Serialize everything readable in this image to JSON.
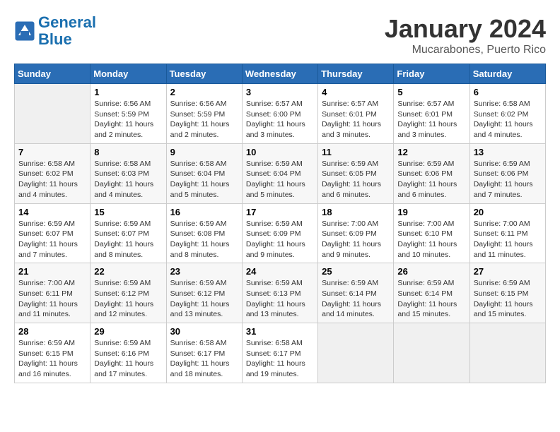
{
  "header": {
    "logo_line1": "General",
    "logo_line2": "Blue",
    "month": "January 2024",
    "location": "Mucarabones, Puerto Rico"
  },
  "days_of_week": [
    "Sunday",
    "Monday",
    "Tuesday",
    "Wednesday",
    "Thursday",
    "Friday",
    "Saturday"
  ],
  "weeks": [
    [
      {
        "day": "",
        "info": ""
      },
      {
        "day": "1",
        "info": "Sunrise: 6:56 AM\nSunset: 5:59 PM\nDaylight: 11 hours\nand 2 minutes."
      },
      {
        "day": "2",
        "info": "Sunrise: 6:56 AM\nSunset: 5:59 PM\nDaylight: 11 hours\nand 2 minutes."
      },
      {
        "day": "3",
        "info": "Sunrise: 6:57 AM\nSunset: 6:00 PM\nDaylight: 11 hours\nand 3 minutes."
      },
      {
        "day": "4",
        "info": "Sunrise: 6:57 AM\nSunset: 6:01 PM\nDaylight: 11 hours\nand 3 minutes."
      },
      {
        "day": "5",
        "info": "Sunrise: 6:57 AM\nSunset: 6:01 PM\nDaylight: 11 hours\nand 3 minutes."
      },
      {
        "day": "6",
        "info": "Sunrise: 6:58 AM\nSunset: 6:02 PM\nDaylight: 11 hours\nand 4 minutes."
      }
    ],
    [
      {
        "day": "7",
        "info": "Sunrise: 6:58 AM\nSunset: 6:02 PM\nDaylight: 11 hours\nand 4 minutes."
      },
      {
        "day": "8",
        "info": "Sunrise: 6:58 AM\nSunset: 6:03 PM\nDaylight: 11 hours\nand 4 minutes."
      },
      {
        "day": "9",
        "info": "Sunrise: 6:58 AM\nSunset: 6:04 PM\nDaylight: 11 hours\nand 5 minutes."
      },
      {
        "day": "10",
        "info": "Sunrise: 6:59 AM\nSunset: 6:04 PM\nDaylight: 11 hours\nand 5 minutes."
      },
      {
        "day": "11",
        "info": "Sunrise: 6:59 AM\nSunset: 6:05 PM\nDaylight: 11 hours\nand 6 minutes."
      },
      {
        "day": "12",
        "info": "Sunrise: 6:59 AM\nSunset: 6:06 PM\nDaylight: 11 hours\nand 6 minutes."
      },
      {
        "day": "13",
        "info": "Sunrise: 6:59 AM\nSunset: 6:06 PM\nDaylight: 11 hours\nand 7 minutes."
      }
    ],
    [
      {
        "day": "14",
        "info": "Sunrise: 6:59 AM\nSunset: 6:07 PM\nDaylight: 11 hours\nand 7 minutes."
      },
      {
        "day": "15",
        "info": "Sunrise: 6:59 AM\nSunset: 6:07 PM\nDaylight: 11 hours\nand 8 minutes."
      },
      {
        "day": "16",
        "info": "Sunrise: 6:59 AM\nSunset: 6:08 PM\nDaylight: 11 hours\nand 8 minutes."
      },
      {
        "day": "17",
        "info": "Sunrise: 6:59 AM\nSunset: 6:09 PM\nDaylight: 11 hours\nand 9 minutes."
      },
      {
        "day": "18",
        "info": "Sunrise: 7:00 AM\nSunset: 6:09 PM\nDaylight: 11 hours\nand 9 minutes."
      },
      {
        "day": "19",
        "info": "Sunrise: 7:00 AM\nSunset: 6:10 PM\nDaylight: 11 hours\nand 10 minutes."
      },
      {
        "day": "20",
        "info": "Sunrise: 7:00 AM\nSunset: 6:11 PM\nDaylight: 11 hours\nand 11 minutes."
      }
    ],
    [
      {
        "day": "21",
        "info": "Sunrise: 7:00 AM\nSunset: 6:11 PM\nDaylight: 11 hours\nand 11 minutes."
      },
      {
        "day": "22",
        "info": "Sunrise: 6:59 AM\nSunset: 6:12 PM\nDaylight: 11 hours\nand 12 minutes."
      },
      {
        "day": "23",
        "info": "Sunrise: 6:59 AM\nSunset: 6:12 PM\nDaylight: 11 hours\nand 13 minutes."
      },
      {
        "day": "24",
        "info": "Sunrise: 6:59 AM\nSunset: 6:13 PM\nDaylight: 11 hours\nand 13 minutes."
      },
      {
        "day": "25",
        "info": "Sunrise: 6:59 AM\nSunset: 6:14 PM\nDaylight: 11 hours\nand 14 minutes."
      },
      {
        "day": "26",
        "info": "Sunrise: 6:59 AM\nSunset: 6:14 PM\nDaylight: 11 hours\nand 15 minutes."
      },
      {
        "day": "27",
        "info": "Sunrise: 6:59 AM\nSunset: 6:15 PM\nDaylight: 11 hours\nand 15 minutes."
      }
    ],
    [
      {
        "day": "28",
        "info": "Sunrise: 6:59 AM\nSunset: 6:15 PM\nDaylight: 11 hours\nand 16 minutes."
      },
      {
        "day": "29",
        "info": "Sunrise: 6:59 AM\nSunset: 6:16 PM\nDaylight: 11 hours\nand 17 minutes."
      },
      {
        "day": "30",
        "info": "Sunrise: 6:58 AM\nSunset: 6:17 PM\nDaylight: 11 hours\nand 18 minutes."
      },
      {
        "day": "31",
        "info": "Sunrise: 6:58 AM\nSunset: 6:17 PM\nDaylight: 11 hours\nand 19 minutes."
      },
      {
        "day": "",
        "info": ""
      },
      {
        "day": "",
        "info": ""
      },
      {
        "day": "",
        "info": ""
      }
    ]
  ]
}
